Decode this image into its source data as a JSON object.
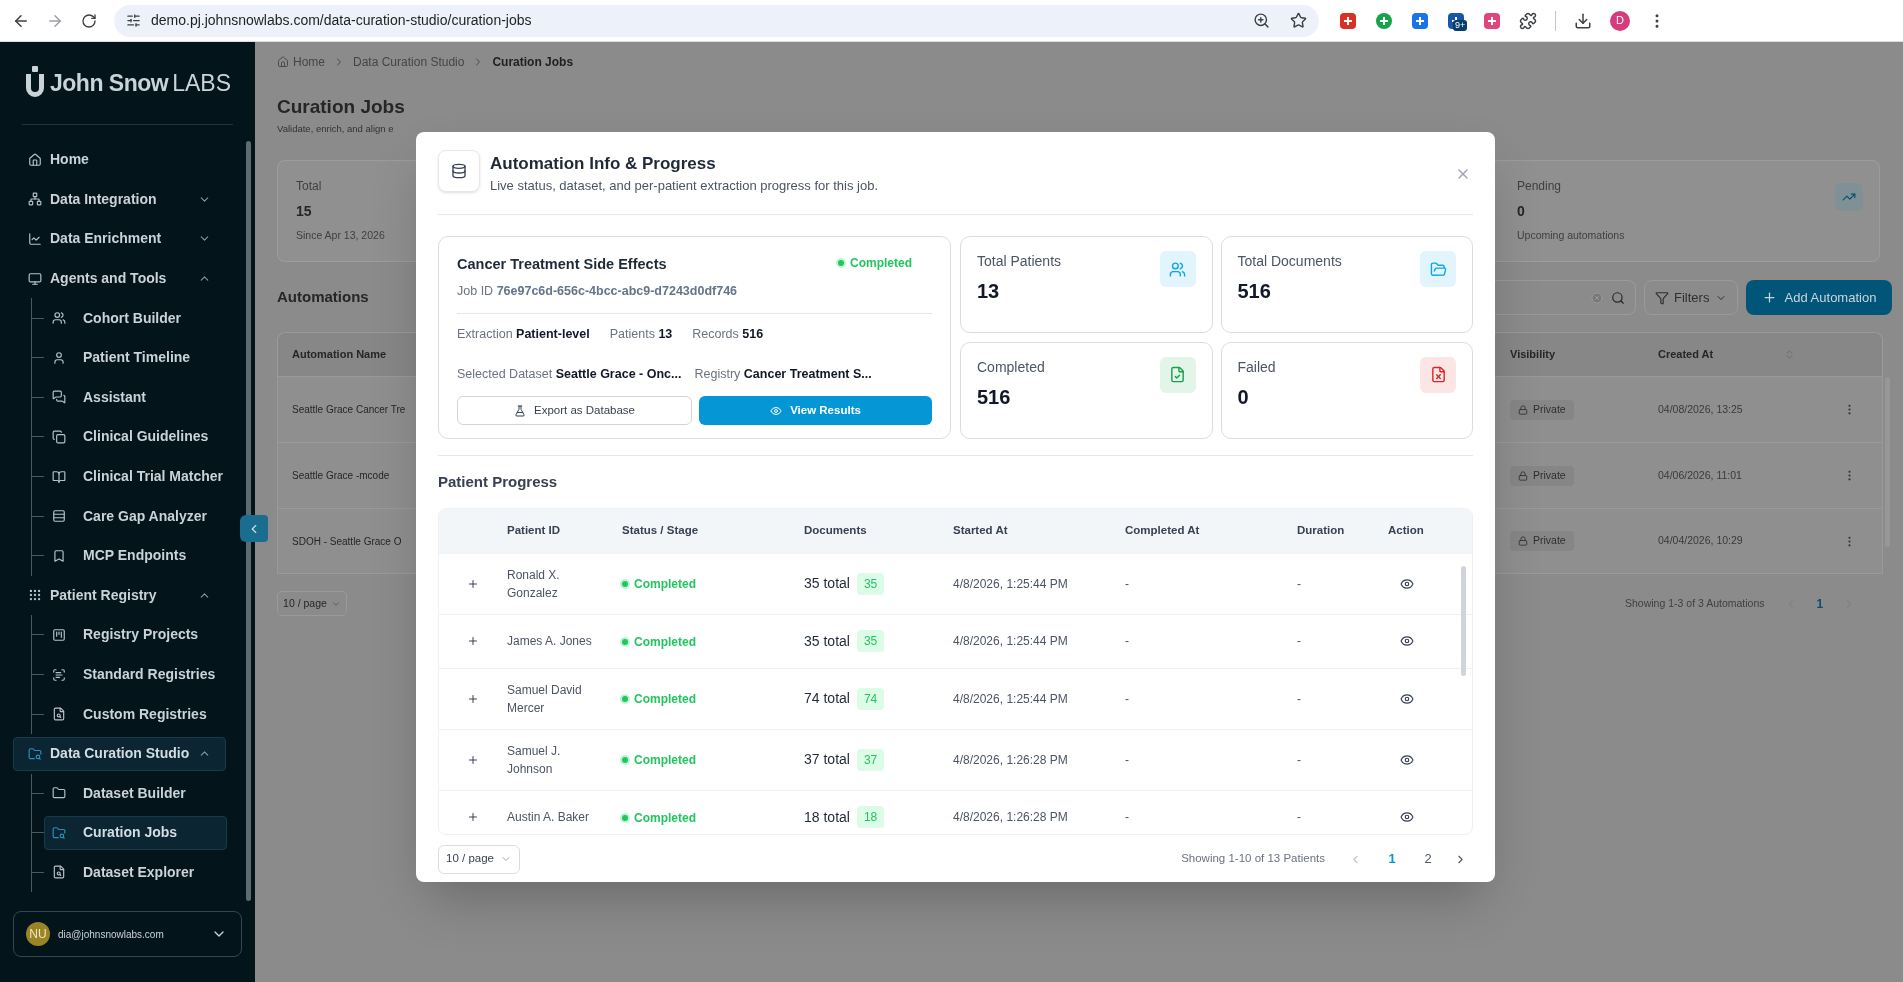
{
  "browser": {
    "url": "demo.pj.johnsnowlabs.com/data-curation-studio/curation-jobs",
    "extension_badge": "9+",
    "profile_initial": "D"
  },
  "sidebar": {
    "brand": {
      "name": "John Snow",
      "suffix": "LABS"
    },
    "items": [
      {
        "label": "Home",
        "selected": false
      },
      {
        "label": "Data Integration",
        "selected": false,
        "expanded": false
      },
      {
        "label": "Data Enrichment",
        "selected": false,
        "expanded": false
      },
      {
        "label": "Agents and Tools",
        "selected": false,
        "expanded": true,
        "children": [
          {
            "label": "Cohort Builder",
            "selected": false
          },
          {
            "label": "Patient Timeline",
            "selected": false
          },
          {
            "label": "Assistant",
            "selected": false
          },
          {
            "label": "Clinical Guidelines",
            "selected": false
          },
          {
            "label": "Clinical Trial Matcher",
            "selected": false
          },
          {
            "label": "Care Gap Analyzer",
            "selected": false
          },
          {
            "label": "MCP Endpoints",
            "selected": false
          }
        ]
      },
      {
        "label": "Patient Registry",
        "selected": false,
        "expanded": true,
        "children": [
          {
            "label": "Registry Projects",
            "selected": false
          },
          {
            "label": "Standard Registries",
            "selected": false
          },
          {
            "label": "Custom Registries",
            "selected": false
          }
        ]
      },
      {
        "label": "Data Curation Studio",
        "selected": true,
        "expanded": true,
        "children": [
          {
            "label": "Dataset Builder",
            "selected": false
          },
          {
            "label": "Curation Jobs",
            "selected": true
          },
          {
            "label": "Dataset Explorer",
            "selected": false
          }
        ]
      }
    ],
    "user": {
      "initials": "NU",
      "email": "dia@johnsnowlabs.com"
    }
  },
  "page": {
    "breadcrumb": [
      {
        "label": "Home",
        "current": false
      },
      {
        "label": "Data Curation Studio",
        "current": false
      },
      {
        "label": "Curation Jobs",
        "current": true
      }
    ],
    "title": "Curation Jobs",
    "subtitle": "Validate, enrich, and align e",
    "stats": [
      {
        "label": "Total",
        "value": "15",
        "note": "Since Apr 13, 2026"
      },
      {
        "label": "Pending",
        "value": "0",
        "note": "Upcoming automations"
      }
    ],
    "automations": {
      "heading": "Automations",
      "filters_button": "Filters",
      "add_button": "Add Automation",
      "columns": [
        "Automation Name",
        "Visibility",
        "Created At"
      ],
      "rows": [
        {
          "name": "Seattle Grace Cancer Tre",
          "visibility": "Private",
          "created": "04/08/2026, 13:25"
        },
        {
          "name": "Seattle Grace -mcode",
          "visibility": "Private",
          "created": "04/06/2026, 11:01"
        },
        {
          "name": "SDOH - Seattle Grace O",
          "visibility": "Private",
          "created": "04/04/2026, 10:29"
        }
      ],
      "page_size": "10 / page",
      "summary": "Showing 1-3 of 3 Automations",
      "pages": [
        {
          "label": "1",
          "selected": true
        }
      ]
    }
  },
  "modal": {
    "title": "Automation Info & Progress",
    "subtitle": "Live status, dataset, and per-patient extraction progress for this job.",
    "job": {
      "name": "Cancer Treatment Side Effects",
      "status": {
        "label": "Completed",
        "kind": "success"
      },
      "job_id_label": "Job ID",
      "job_id": "76e97c6d-656c-4bcc-abc9-d7243d0df746",
      "field_rows": [
        [
          {
            "label": "Extraction",
            "value": "Patient-level"
          },
          {
            "label": "Patients",
            "value": "13"
          },
          {
            "label": "Records",
            "value": "516"
          }
        ],
        [
          {
            "label": "Selected Dataset",
            "value": "Seattle Grace - Onc..."
          },
          {
            "label": "Registry",
            "value": "Cancer Treatment S..."
          }
        ]
      ],
      "export_button": "Export as Database",
      "view_button": "View Results"
    },
    "metrics": [
      {
        "label": "Total Patients",
        "value": "13",
        "color": "#0ea5e9"
      },
      {
        "label": "Total Documents",
        "value": "516",
        "color": "#0ea5e9"
      },
      {
        "label": "Completed",
        "value": "516",
        "color": "#16a34a"
      },
      {
        "label": "Failed",
        "value": "0",
        "color": "#dc2626"
      }
    ],
    "progress": {
      "heading": "Patient Progress",
      "columns": [
        "Patient ID",
        "Status / Stage",
        "Documents",
        "Started At",
        "Completed At",
        "Duration",
        "Action"
      ],
      "rows": [
        {
          "patient": "Ronald X. Gonzalez",
          "expanded": false,
          "status": {
            "label": "Completed",
            "kind": "success"
          },
          "documents": "35 total",
          "count": "35",
          "started": "4/8/2026, 1:25:44 PM",
          "completed": "-",
          "duration": "-"
        },
        {
          "patient": "James A. Jones",
          "expanded": false,
          "status": {
            "label": "Completed",
            "kind": "success"
          },
          "documents": "35 total",
          "count": "35",
          "started": "4/8/2026, 1:25:44 PM",
          "completed": "-",
          "duration": "-"
        },
        {
          "patient": "Samuel David Mercer",
          "expanded": false,
          "status": {
            "label": "Completed",
            "kind": "success"
          },
          "documents": "74 total",
          "count": "74",
          "started": "4/8/2026, 1:25:44 PM",
          "completed": "-",
          "duration": "-"
        },
        {
          "patient": "Samuel J. Johnson",
          "expanded": false,
          "status": {
            "label": "Completed",
            "kind": "success"
          },
          "documents": "37 total",
          "count": "37",
          "started": "4/8/2026, 1:26:28 PM",
          "completed": "-",
          "duration": "-"
        },
        {
          "patient": "Austin A. Baker",
          "expanded": false,
          "status": {
            "label": "Completed",
            "kind": "success"
          },
          "documents": "18 total",
          "count": "18",
          "started": "4/8/2026, 1:26:28 PM",
          "completed": "-",
          "duration": "-"
        }
      ],
      "page_size": "10 / page",
      "summary": "Showing 1-10 of 13 Patients",
      "pages": [
        {
          "label": "1",
          "selected": true
        },
        {
          "label": "2",
          "selected": false
        }
      ]
    }
  }
}
